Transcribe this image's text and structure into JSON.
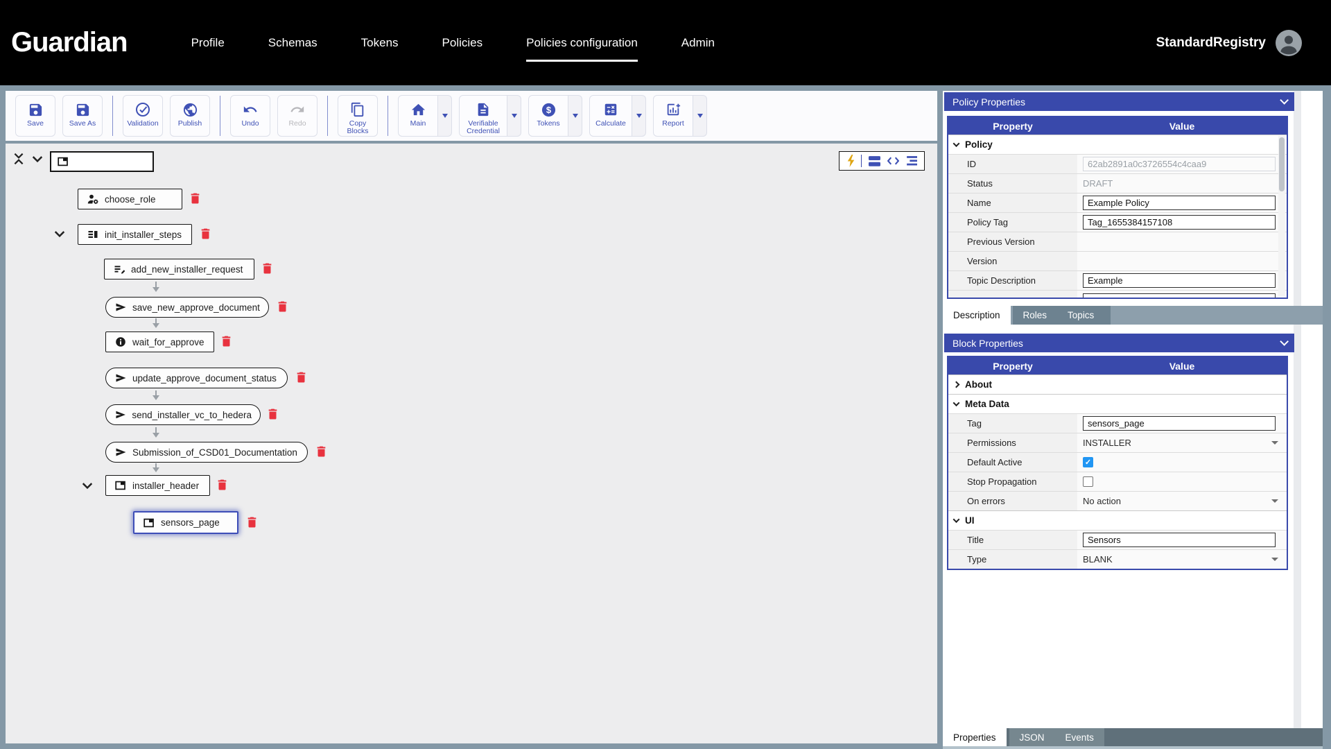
{
  "header": {
    "logo": "Guardian",
    "nav": [
      {
        "label": "Profile"
      },
      {
        "label": "Schemas"
      },
      {
        "label": "Tokens"
      },
      {
        "label": "Policies"
      },
      {
        "label": "Policies configuration",
        "active": true
      },
      {
        "label": "Admin"
      }
    ],
    "user": "StandardRegistry",
    "avatar_icon": "user-avatar-icon"
  },
  "toolbar": {
    "buttons": [
      {
        "label": "Save",
        "icon": "save-icon"
      },
      {
        "label": "Save As",
        "icon": "save-as-icon"
      },
      {
        "label": "Validation",
        "icon": "validation-check-icon"
      },
      {
        "label": "Publish",
        "icon": "publish-globe-icon"
      },
      {
        "label": "Undo",
        "icon": "undo-icon"
      },
      {
        "label": "Redo",
        "icon": "redo-icon",
        "disabled": true
      },
      {
        "label": "Copy Blocks",
        "icon": "copy-blocks-icon"
      },
      {
        "label": "Main",
        "icon": "home-icon",
        "dropdown": true
      },
      {
        "label": "Verifiable Credential",
        "icon": "verifiable-credential-icon",
        "dropdown": true
      },
      {
        "label": "Tokens",
        "icon": "tokens-dollar-icon",
        "dropdown": true
      },
      {
        "label": "Calculate",
        "icon": "calculate-icon",
        "dropdown": true
      },
      {
        "label": "Report",
        "icon": "report-chart-icon",
        "dropdown": true
      }
    ]
  },
  "canvas": {
    "view_toolbar_icons": [
      "flash-icon",
      "blocks-view-icon",
      "code-view-icon",
      "tree-view-icon"
    ],
    "root_icon": "container-icon",
    "blocks": [
      {
        "label": "choose_role",
        "icon": "roles-icon"
      },
      {
        "label": "init_installer_steps",
        "icon": "steps-icon",
        "expandable": true
      },
      {
        "label": "add_new_installer_request",
        "icon": "request-icon"
      },
      {
        "label": "save_new_approve_document",
        "icon": "send-icon",
        "shape": "pill"
      },
      {
        "label": "wait_for_approve",
        "icon": "info-icon"
      },
      {
        "label": "update_approve_document_status",
        "icon": "send-icon",
        "shape": "pill"
      },
      {
        "label": "send_installer_vc_to_hedera",
        "icon": "send-icon",
        "shape": "pill"
      },
      {
        "label": "Submission_of_CSD01_Documentation",
        "icon": "send-icon",
        "shape": "pill"
      },
      {
        "label": "installer_header",
        "icon": "container-icon",
        "expandable": true
      },
      {
        "label": "sensors_page",
        "icon": "container-icon",
        "selected": true
      }
    ]
  },
  "policy_properties": {
    "title": "Policy Properties",
    "columns": {
      "property": "Property",
      "value": "Value"
    },
    "rows": [
      {
        "type": "group",
        "label": "Policy"
      },
      {
        "type": "readonly",
        "label": "ID",
        "value": "62ab2891a0c3726554c4caa9"
      },
      {
        "type": "readonly",
        "label": "Status",
        "value": "DRAFT"
      },
      {
        "type": "input",
        "label": "Name",
        "value": "Example Policy"
      },
      {
        "type": "input",
        "label": "Policy Tag",
        "value": "Tag_1655384157108"
      },
      {
        "type": "empty",
        "label": "Previous Version"
      },
      {
        "type": "empty",
        "label": "Version"
      },
      {
        "type": "input",
        "label": "Topic Description",
        "value": "Example"
      }
    ]
  },
  "description_tabs": [
    {
      "label": "Description",
      "active": true
    },
    {
      "label": "Roles"
    },
    {
      "label": "Topics"
    }
  ],
  "block_properties": {
    "title": "Block Properties",
    "columns": {
      "property": "Property",
      "value": "Value"
    },
    "rows": [
      {
        "type": "group",
        "label": "About",
        "collapsed": true
      },
      {
        "type": "group",
        "label": "Meta Data"
      },
      {
        "type": "input",
        "label": "Tag",
        "value": "sensors_page"
      },
      {
        "type": "select",
        "label": "Permissions",
        "value": "INSTALLER"
      },
      {
        "type": "checkbox",
        "label": "Default Active",
        "checked": true
      },
      {
        "type": "checkbox",
        "label": "Stop Propagation",
        "checked": false
      },
      {
        "type": "select",
        "label": "On errors",
        "value": "No action"
      },
      {
        "type": "group",
        "label": "UI"
      },
      {
        "type": "input",
        "label": "Title",
        "value": "Sensors"
      },
      {
        "type": "select",
        "label": "Type",
        "value": "BLANK"
      }
    ]
  },
  "bottom_tabs": [
    {
      "label": "Properties",
      "active": true
    },
    {
      "label": "JSON"
    },
    {
      "label": "Events"
    }
  ],
  "colors": {
    "accent": "#3949ab",
    "toolbar_icon_blue": "#3f51b5",
    "delete_red": "#e8323e",
    "checkbox_blue": "#2196f3",
    "lightning_yellow": "#dfa512",
    "background_gray": "#8498a6"
  }
}
